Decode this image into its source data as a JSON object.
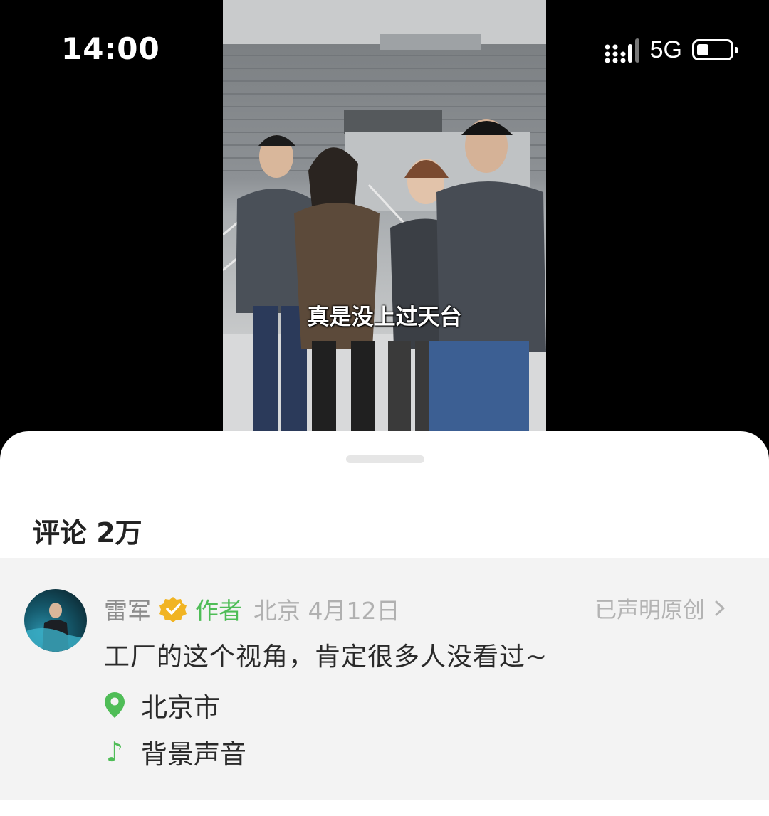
{
  "status_bar": {
    "time": "14:00",
    "network": "5G"
  },
  "video": {
    "subtitle": "真是没上过天台"
  },
  "comments": {
    "title": "评论 2万",
    "items": [
      {
        "user": "雷军",
        "author_label": "作者",
        "location_date": "北京 4月12日",
        "original_statement": "已声明原创",
        "text": "工厂的这个视角，肯定很多人没看过~",
        "place": "北京市",
        "music": "背景声音",
        "icons": [
          "verified-badge-icon",
          "chevron-right-icon",
          "location-pin-icon",
          "music-note-icon"
        ]
      }
    ]
  },
  "colors": {
    "accent_green": "#4fbd57",
    "verified_gold": "#f1b423"
  }
}
